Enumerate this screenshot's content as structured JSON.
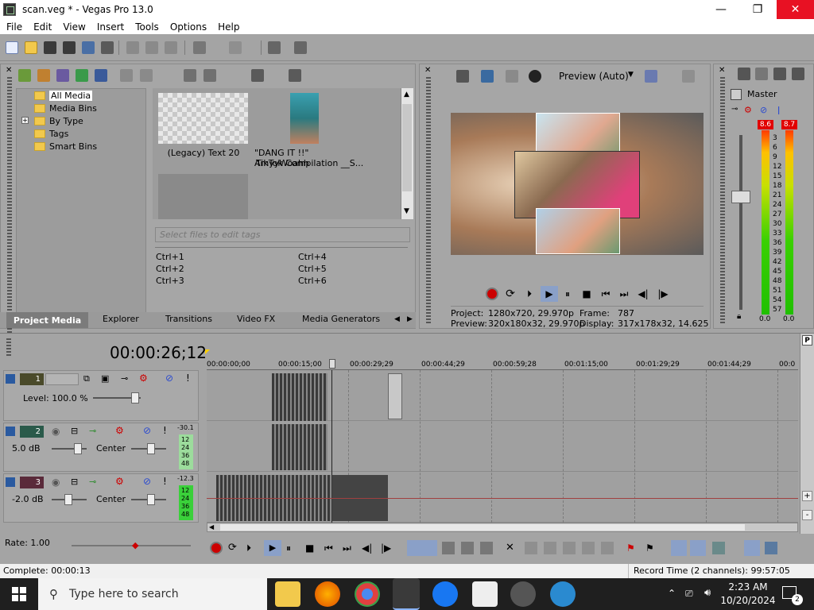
{
  "window": {
    "title": "scan.veg * - Vegas Pro 13.0",
    "min_glyph": "—",
    "max_glyph": "❐",
    "close_glyph": "✕"
  },
  "menu": [
    "File",
    "Edit",
    "View",
    "Insert",
    "Tools",
    "Options",
    "Help"
  ],
  "media": {
    "tree": [
      "All Media",
      "Media Bins",
      "By Type",
      "Tags",
      "Smart Bins"
    ],
    "expander": "+",
    "items": [
      {
        "label": "(Legacy) Text 20"
      },
      {
        "label_line1": "\"DANG IT !!\" AmyyWoahh",
        "label_line2": "TikTok Compilation __S..."
      }
    ],
    "tag_placeholder": "Select files to edit tags",
    "shortcuts": [
      "Ctrl+1",
      "Ctrl+2",
      "Ctrl+3",
      "Ctrl+4",
      "Ctrl+5",
      "Ctrl+6"
    ],
    "tabs": [
      "Project Media",
      "Explorer",
      "Transitions",
      "Video FX",
      "Media Generators"
    ]
  },
  "preview": {
    "mode": "Preview (Auto)",
    "project_label": "Project:",
    "project_value": "1280x720, 29.970p",
    "preview_label": "Preview:",
    "preview_value": "320x180x32, 29.970p",
    "frame_label": "Frame:",
    "frame_value": "787",
    "display_label": "Display:",
    "display_value": "317x178x32, 14.625"
  },
  "master": {
    "title": "Master",
    "peak_left": "8.6",
    "peak_right": "8.7",
    "scale": [
      "3",
      "6",
      "9",
      "12",
      "15",
      "18",
      "21",
      "24",
      "27",
      "30",
      "33",
      "36",
      "39",
      "42",
      "45",
      "48",
      "51",
      "54",
      "57"
    ],
    "bottom_left": "0.0",
    "bottom_right": "0.0"
  },
  "timeline": {
    "timecode": "00:00:26;12",
    "ruler": [
      "00:00:00;00",
      "00:00:15;00",
      "00:00:29;29",
      "00:00:44;29",
      "00:00:59;28",
      "00:01:15;00",
      "00:01:29;29",
      "00:01:44;29",
      "00:0"
    ],
    "tracks": [
      {
        "num": "1",
        "type": "video",
        "level": "Level: 100.0 %"
      },
      {
        "num": "2",
        "type": "audio",
        "volume": "5.0 dB",
        "pan": "Center",
        "meter_top": "-30.1",
        "meter_scale": [
          "12",
          "24",
          "36",
          "48"
        ]
      },
      {
        "num": "3",
        "type": "audio",
        "volume": "-2.0 dB",
        "pan": "Center",
        "meter_top": "-12.3",
        "meter_scale": [
          "12",
          "24",
          "36",
          "48"
        ]
      }
    ],
    "rate": "Rate: 1.00",
    "side_buttons": [
      "P",
      "+",
      "-"
    ]
  },
  "status": {
    "left": "Complete: 00:00:13",
    "right": "Record Time (2 channels): 99:57:05"
  },
  "taskbar": {
    "search_placeholder": "Type here to search",
    "time": "2:23 AM",
    "date": "10/20/2024",
    "notifications": "2"
  }
}
